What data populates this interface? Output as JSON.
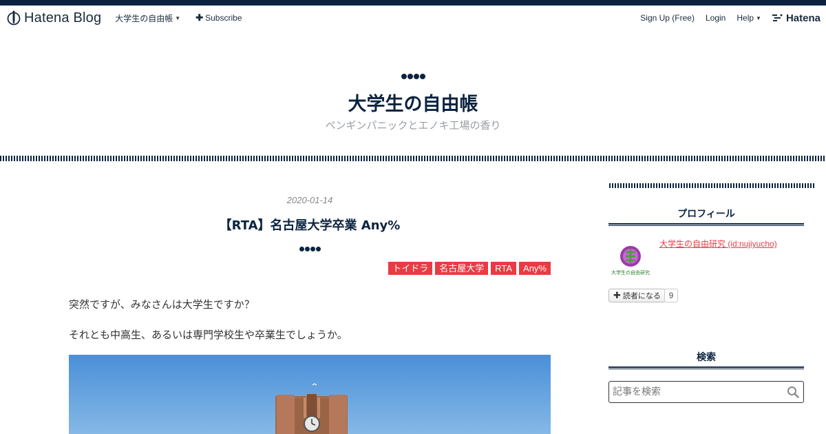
{
  "global_header": {
    "logo_text": "Hatena Blog",
    "blog_menu_label": "大学生の自由帳",
    "subscribe_label": "Subscribe",
    "signup_label": "Sign Up (Free)",
    "login_label": "Login",
    "help_label": "Help",
    "hatena_label": "Hatena"
  },
  "blog": {
    "title": "大学生の自由帳",
    "description": "ペンギンパニックとエノキ工場の香り"
  },
  "entry": {
    "date": "2020-01-14",
    "title": "【RTA】名古屋大学卒業 Any%",
    "categories": [
      "トイドラ",
      "名古屋大学",
      "RTA",
      "Any%"
    ],
    "paragraphs": [
      "突然ですが、みなさんは大学生ですか？",
      "それとも中高生、あるいは専門学校生や卒業生でしょうか。"
    ]
  },
  "sidebar": {
    "profile": {
      "heading": "プロフィール",
      "name": "大学生の自由研究 (id:nujiyucho)",
      "icon_caption": "大学生の自由研究",
      "subscribe_label": "読者になる",
      "reader_count": "9"
    },
    "search": {
      "heading": "検索",
      "placeholder": "記事を検索"
    }
  },
  "colors": {
    "navy": "#0b2340",
    "accent_red": "#e83b43",
    "muted_text": "#9aa0a6"
  },
  "icons": [
    "hatena-blog-logo-icon",
    "caret-down-icon",
    "plus-icon",
    "hatena-logo-icon",
    "search-icon"
  ]
}
